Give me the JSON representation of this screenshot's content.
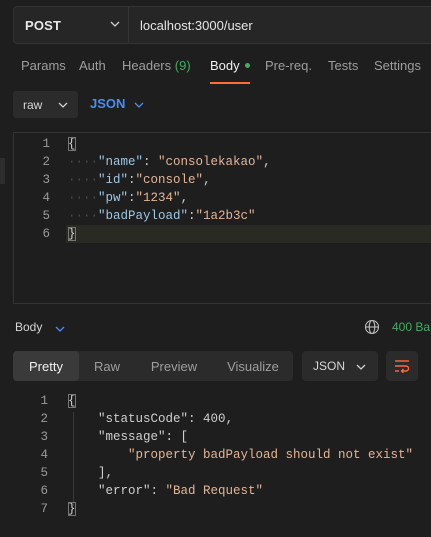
{
  "request": {
    "method": "POST",
    "url": "localhost:3000/user"
  },
  "tabs": [
    {
      "label": "Params"
    },
    {
      "label": "Auth"
    },
    {
      "label": "Headers",
      "count": "(9)"
    },
    {
      "label": "Body"
    },
    {
      "label": "Pre-req."
    },
    {
      "label": "Tests"
    },
    {
      "label": "Settings"
    }
  ],
  "body_options": {
    "mode": "raw",
    "language": "JSON"
  },
  "request_body": {
    "line_numbers": [
      "1",
      "2",
      "3",
      "4",
      "5",
      "6"
    ],
    "lines": {
      "l1": "{",
      "l2_key": "\"name\"",
      "l2_sep": ": ",
      "l2_val": "\"consolekakao\"",
      "l2_end": ",",
      "l3_key": "\"id\"",
      "l3_sep": ":",
      "l3_val": "\"console\"",
      "l3_end": ",",
      "l4_key": "\"pw\"",
      "l4_sep": ":",
      "l4_val": "\"1234\"",
      "l4_end": ",",
      "l5_key": "\"badPayload\"",
      "l5_sep": ":",
      "l5_val": "\"1a2b3c\"",
      "l6": "}"
    }
  },
  "response": {
    "section_label": "Body",
    "status": "400 Ba",
    "view_tabs": [
      "Pretty",
      "Raw",
      "Preview",
      "Visualize"
    ],
    "format": "JSON",
    "line_numbers": [
      "1",
      "2",
      "3",
      "4",
      "5",
      "6",
      "7"
    ],
    "lines": {
      "l1": "{",
      "l2_key": "\"statusCode\"",
      "l2_sep": ": ",
      "l2_val": "400",
      "l2_end": ",",
      "l3_key": "\"message\"",
      "l3_rest": ": [",
      "l4_val": "\"property badPayload should not exist\"",
      "l5": "],",
      "l6_key": "\"error\"",
      "l6_sep": ": ",
      "l6_val": "\"Bad Request\"",
      "l7": "}"
    }
  },
  "colors": {
    "accent": "#ff6c37",
    "status_green": "#3fae62",
    "link_blue": "#4b8ef0"
  }
}
